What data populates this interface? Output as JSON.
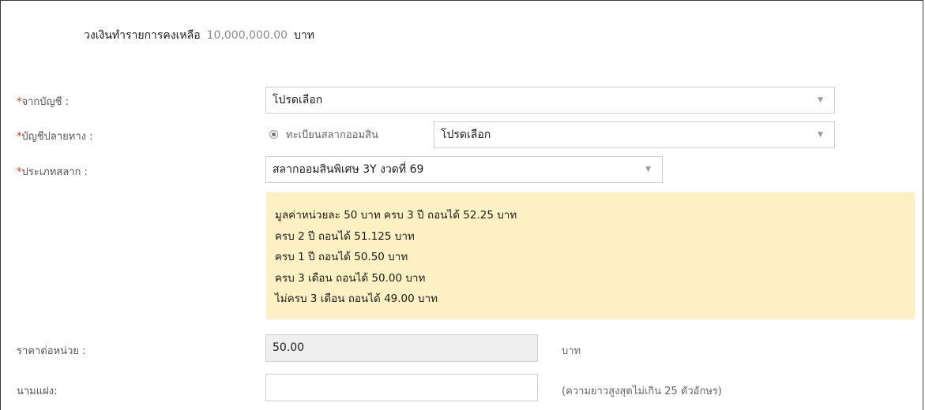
{
  "limit": {
    "label": "วงเงินทำรายการคงเหลือ",
    "amount": "10,000,000.00",
    "unit": "บาท"
  },
  "from_account": {
    "required_mark": "*",
    "label": "จากบัญชี :",
    "value": "โปรดเลือก"
  },
  "dest_account": {
    "required_mark": "*",
    "label": "บัญชีปลายทาง :",
    "radio_label": "ทะเบียนสลากออมสิน",
    "radio_selected": true,
    "value": "โปรดเลือก"
  },
  "lottery_type": {
    "required_mark": "*",
    "label": "ประเภทสลาก :",
    "value": "สลากออมสินพิเศษ 3Y งวดที่ 69"
  },
  "info_lines": [
    "มูลค่าหน่วยละ 50 บาท ครบ 3 ปี ถอนได้ 52.25 บาท",
    "ครบ 2 ปี ถอนได้ 51.125 บาท",
    "ครบ 1 ปี ถอนได้ 50.50 บาท",
    "ครบ 3 เดือน ถอนได้ 50.00 บาท",
    "ไม่ครบ 3 เดือน ถอนได้ 49.00 บาท"
  ],
  "unit_price": {
    "label": "ราคาต่อหน่วย :",
    "value": "50.00",
    "unit": "บาท"
  },
  "nickname": {
    "label": "นามแฝง:",
    "value": "",
    "hint": "(ความยาวสูงสุดไม่เกิน 25 ตัวอักษร)"
  },
  "icons": {
    "dropdown": "caret-down-icon",
    "radio": "radio-selected-icon"
  },
  "colors": {
    "required": "#e0321b",
    "info_bg": "#fdf1c3",
    "readonly_bg": "#efefef"
  }
}
